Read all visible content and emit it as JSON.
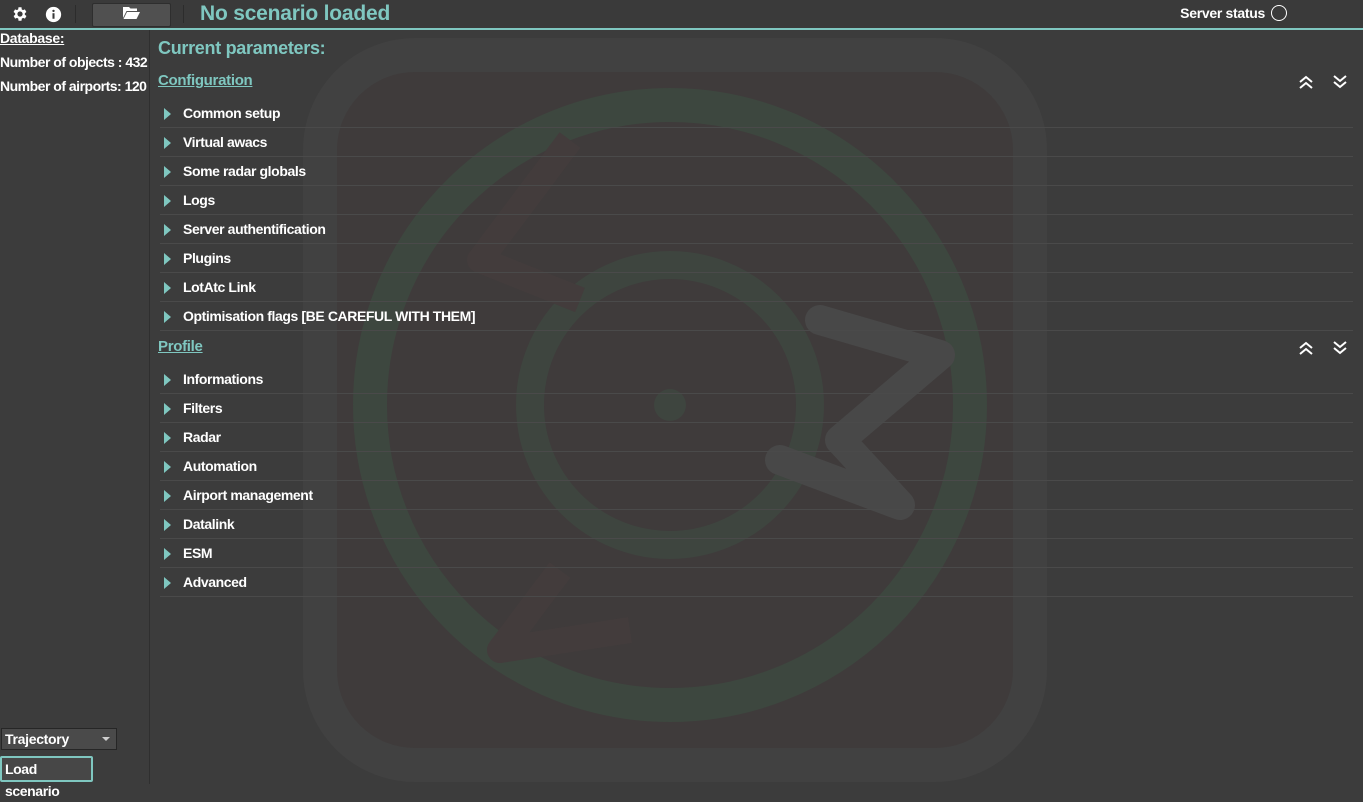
{
  "topbar": {
    "scenario_title": "No scenario loaded",
    "server_status_label": "Server status",
    "icons": [
      "gear-icon",
      "info-icon",
      "folder-open-icon"
    ]
  },
  "sidebar": {
    "database_title": "Database:",
    "objects_count": "Number of objects : 432",
    "airports_count": "Number of airports: 120",
    "selector_value": "Trajectory",
    "load_button": "Load scenario"
  },
  "main": {
    "params_title": "Current parameters:",
    "configuration": {
      "title": "Configuration",
      "items": [
        "Common setup",
        "Virtual awacs",
        "Some radar globals",
        "Logs",
        "Server authentification",
        "Plugins",
        "LotAtc Link",
        "Optimisation flags [BE CAREFUL WITH THEM]"
      ]
    },
    "profile": {
      "title": "Profile",
      "items": [
        "Informations",
        "Filters",
        "Radar",
        "Automation",
        "Airport management",
        "Datalink",
        "ESM",
        "Advanced"
      ]
    }
  },
  "colors": {
    "accent": "#7fc7c0",
    "background": "#3c3c3c",
    "text": "#ffffff"
  }
}
